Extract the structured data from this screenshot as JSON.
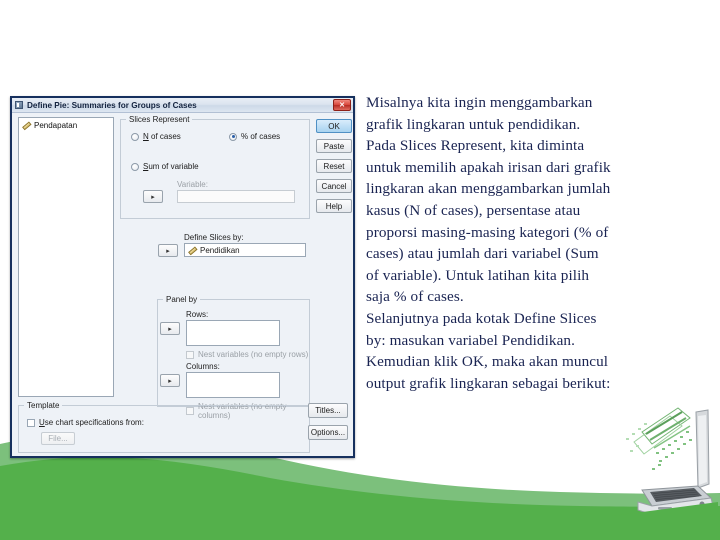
{
  "slide": {
    "narration": [
      "Misalnya kita ingin menggambarkan",
      "grafik lingkaran untuk pendidikan.",
      "Pada Slices Represent, kita diminta",
      "untuk memilih apakah irisan dari grafik",
      "lingkaran akan menggambarkan jumlah",
      "kasus (N of cases), persentase atau",
      "proporsi masing-masing kategori (% of",
      "cases) atau jumlah dari variabel (Sum",
      "of variable). Untuk latihan kita pilih",
      "saja % of cases.",
      "Selanjutnya pada kotak Define Slices",
      "by: masukan variabel Pendidikan.",
      "Kemudian klik OK, maka akan muncul",
      "output grafik lingkaran sebagai berikut:"
    ],
    "text_color": "#1a2452",
    "accent_green_light": "#7cc07c",
    "accent_green": "#54b04b"
  },
  "dialog": {
    "title": "Define Pie: Summaries for Groups of Cases",
    "close_glyph": "✕",
    "variable_list": [
      {
        "name": "Pendapatan",
        "icon": "scale-ruler-icon"
      }
    ],
    "slices_represent": {
      "legend": "Slices Represent",
      "options": [
        {
          "label_prefix": "N",
          "label_rest": " of cases",
          "selected": false
        },
        {
          "label_prefix": "%",
          "label_rest": " of cases",
          "selected": true
        },
        {
          "label_prefix": "S",
          "label_rest": "um of variable",
          "selected": false
        }
      ],
      "variable_label": "Variable:",
      "variable_value": "",
      "arrow_glyph": "▸"
    },
    "define_slices": {
      "label": "Define Slices by:",
      "value": "Pendidikan",
      "icon": "scale-ruler-icon",
      "arrow_glyph": "▸"
    },
    "panel_by": {
      "legend": "Panel by",
      "rows_label": "Rows:",
      "rows_value": "",
      "rows_nest_label": "Nest variables (no empty rows)",
      "rows_nest_checked": false,
      "columns_label": "Columns:",
      "columns_value": "",
      "columns_nest_label": "Nest variables (no empty columns)",
      "columns_nest_checked": false,
      "arrow_glyph": "▸"
    },
    "template": {
      "legend": "Template",
      "checkbox_label": "Use chart specifications from:",
      "checked": false,
      "file_button": "File..."
    },
    "action_buttons": [
      {
        "label": "OK",
        "primary": true
      },
      {
        "label": "Paste",
        "primary": false
      },
      {
        "label": "Reset",
        "primary": false
      },
      {
        "label": "Cancel",
        "primary": false
      },
      {
        "label": "Help",
        "primary": false
      }
    ],
    "extra_buttons": [
      {
        "label": "Titles..."
      },
      {
        "label": "Options..."
      }
    ]
  }
}
